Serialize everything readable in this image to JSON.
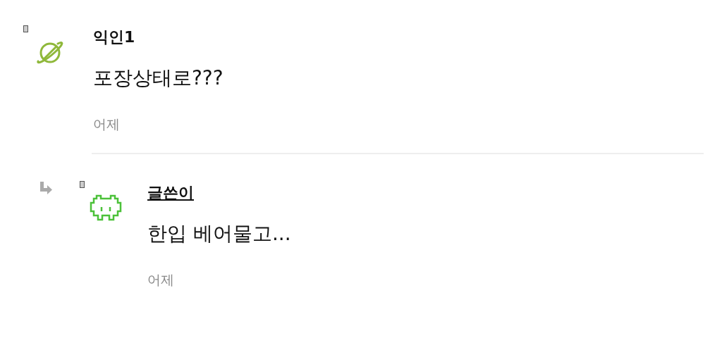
{
  "comments": [
    {
      "kind": "comment",
      "name": "익인1",
      "is_author": false,
      "text": "포장상태로???",
      "time": "어제",
      "avatar": {
        "kind": "planet"
      }
    },
    {
      "kind": "reply",
      "name": "글쓴이",
      "is_author": true,
      "text": "한입 베어물고...",
      "time": "어제",
      "avatar": {
        "kind": "invader"
      }
    }
  ]
}
